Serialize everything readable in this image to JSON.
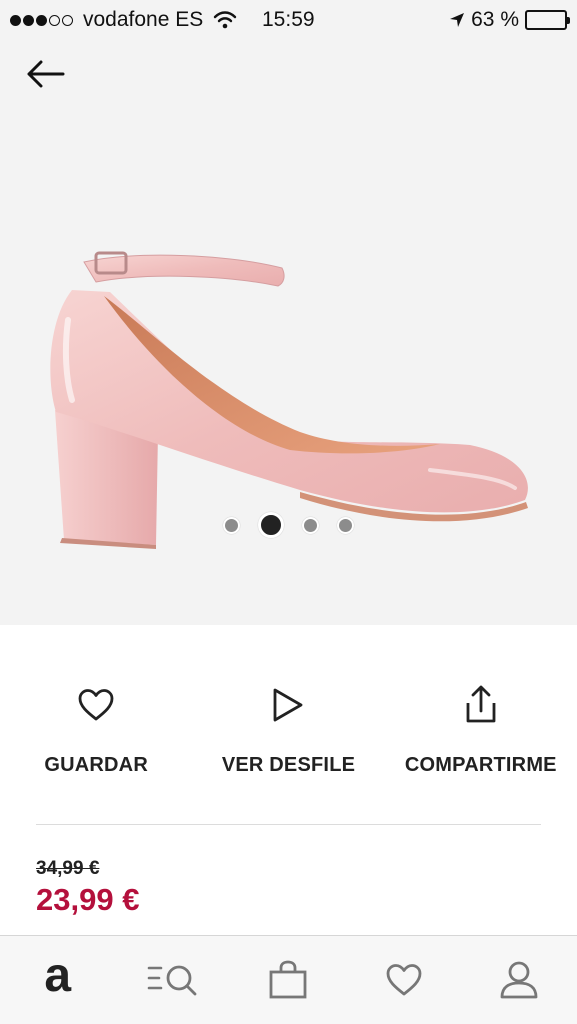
{
  "status_bar": {
    "carrier": "vodafone ES",
    "time": "15:59",
    "battery_percent_text": "63 %",
    "signal_bars_filled": 3,
    "signal_bars_total": 5,
    "battery_level": 0.63
  },
  "product": {
    "image_description_icon": "shoe-image",
    "gallery": {
      "count": 4,
      "active_index": 1
    },
    "price_old": "34,99 €",
    "price_new": "23,99 €"
  },
  "actions": [
    {
      "label": "GUARDAR",
      "icon": "heart-icon"
    },
    {
      "label": "VER DESFILE",
      "icon": "play-icon"
    },
    {
      "label": "COMPARTIRME",
      "icon": "share-icon"
    }
  ],
  "tabbar": {
    "items": [
      {
        "icon": "logo-icon",
        "text": "a"
      },
      {
        "icon": "search-icon"
      },
      {
        "icon": "bag-icon"
      },
      {
        "icon": "heart-icon"
      },
      {
        "icon": "profile-icon"
      }
    ]
  },
  "colors": {
    "sale_price": "#b4103c",
    "text": "#222222",
    "hero_background": "#f3f3f3"
  }
}
